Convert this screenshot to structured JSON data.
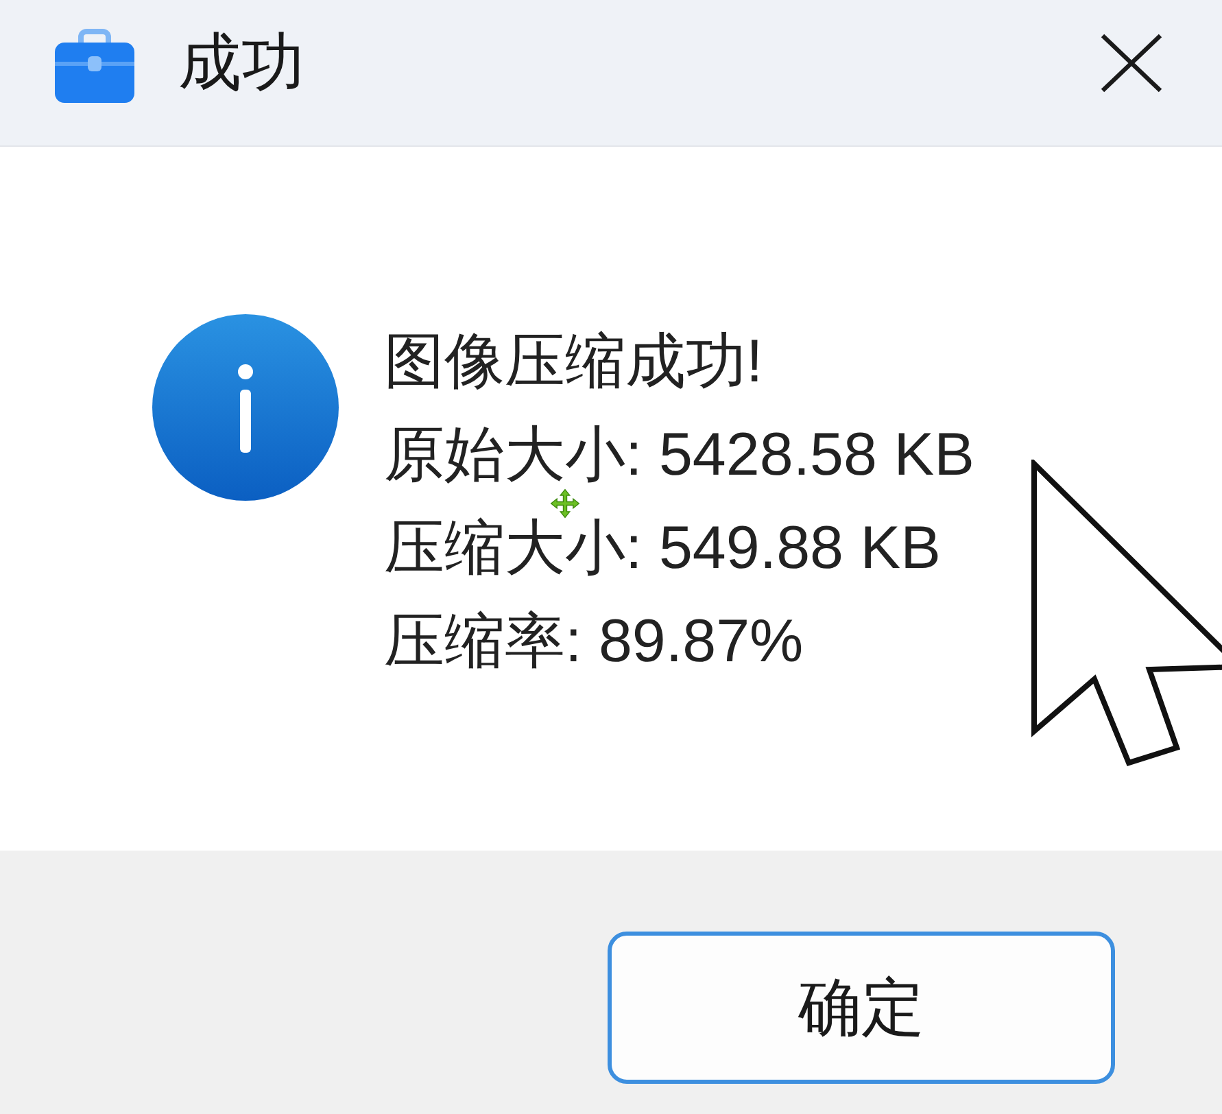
{
  "window": {
    "title": "成功"
  },
  "message": {
    "lines": [
      "图像压缩成功!",
      "原始大小: 5428.58 KB",
      "压缩大小: 549.88 KB",
      "压缩率: 89.87%"
    ]
  },
  "buttons": [
    {
      "label": "确定",
      "default": true
    }
  ]
}
